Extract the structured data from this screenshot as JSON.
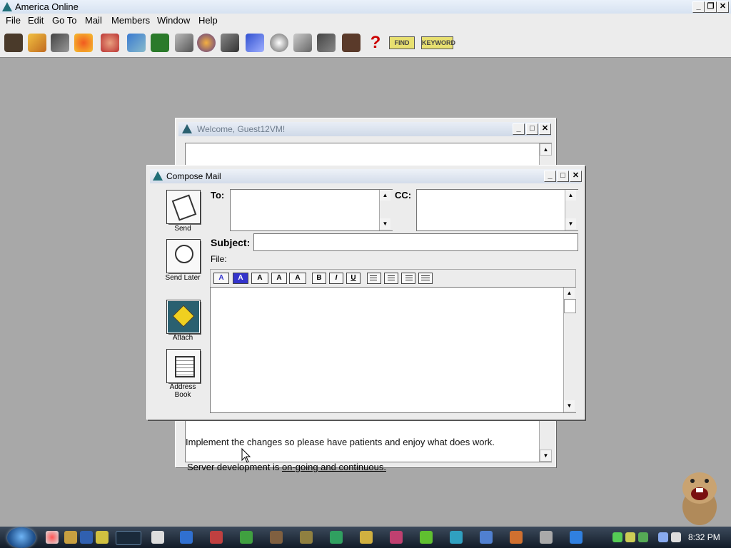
{
  "app": {
    "title": "America  Online"
  },
  "menu": [
    "File",
    "Edit",
    "Go To",
    "Mail",
    "Members",
    "Window",
    "Help"
  ],
  "toolbar": {
    "icons": [
      "read-mail-icon",
      "write-mail-icon",
      "mail-center-icon",
      "print-icon",
      "my-files-icon",
      "my-aol-icon",
      "favorites-icon",
      "internet-icon",
      "channels-icon",
      "people-icon",
      "quotes-icon",
      "perks-icon",
      "weather-icon",
      "shopping-icon",
      "clock-icon",
      "stocks-icon",
      "calendar-icon",
      "help-icon"
    ],
    "find_label": "FIND",
    "keyword_label": "KEYWORD"
  },
  "welcome": {
    "title": "Welcome, Guest12VM!",
    "text_partial": "Implement the changes so please have patients and enjoy what does work.",
    "text_line_prefix": "Server development is ",
    "text_line_link": "on-going and continuous."
  },
  "compose": {
    "title": "Compose Mail",
    "side_buttons": [
      {
        "label": "Send",
        "icon": "send-icon"
      },
      {
        "label": "Send Later",
        "icon": "send-later-icon"
      },
      {
        "label": "Attach",
        "icon": "attach-icon"
      },
      {
        "label": "Address Book",
        "icon": "address-book-icon"
      }
    ],
    "to_label": "To:",
    "cc_label": "CC:",
    "subject_label": "Subject:",
    "file_label": "File:",
    "to_value": "",
    "cc_value": "",
    "subject_value": "",
    "body_value": "",
    "format_buttons": [
      "A",
      "A",
      "A",
      "A",
      "A",
      "B",
      "I",
      "U",
      "left",
      "center",
      "right",
      "justify"
    ]
  },
  "taskbar": {
    "clock": "8:32 PM"
  }
}
